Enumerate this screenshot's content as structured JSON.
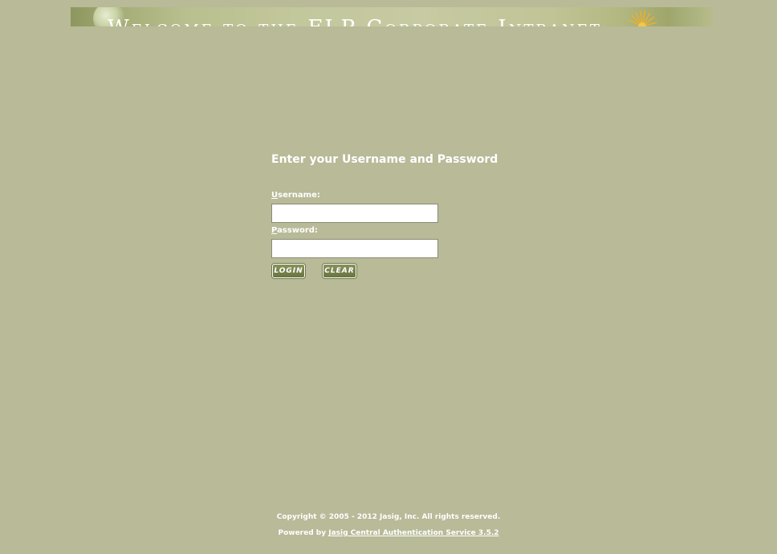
{
  "banner": {
    "text": "Welcome to the FLP Corporate Intranet"
  },
  "login": {
    "heading": "Enter your Username and Password",
    "username_label_key": "U",
    "username_label_rest": "sername:",
    "username_value": "",
    "password_label_key": "P",
    "password_label_rest": "assword:",
    "password_value": "",
    "login_button": "LOGIN",
    "clear_button": "CLEAR"
  },
  "footer": {
    "copyright": "Copyright © 2005 - 2012 Jasig, Inc. All rights reserved.",
    "powered_prefix": "Powered by",
    "powered_link": "Jasig Central Authentication Service 3.5.2"
  },
  "colors": {
    "background": "#b8ba98",
    "button": "#7a8550",
    "text": "#ffffff"
  }
}
